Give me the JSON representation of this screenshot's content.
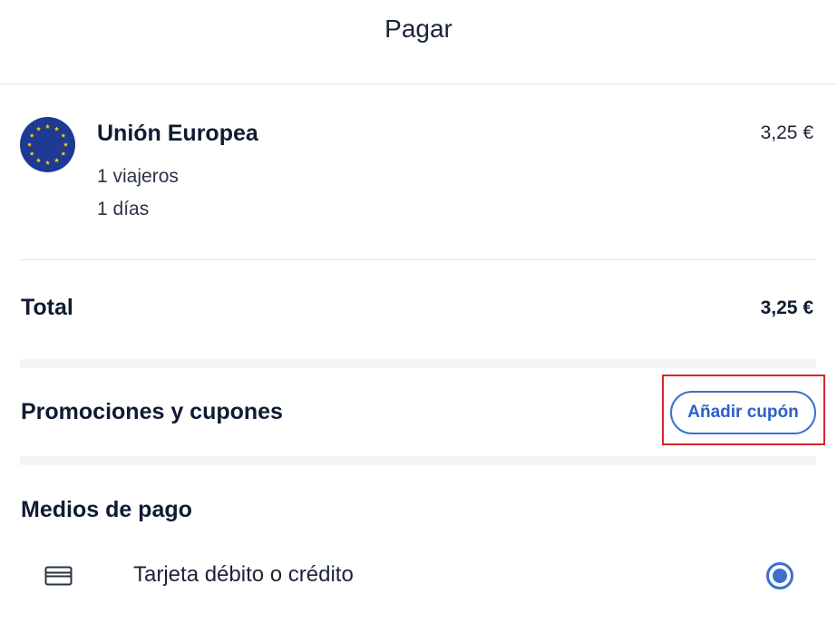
{
  "header": {
    "title": "Pagar"
  },
  "plan": {
    "flag_icon": "eu-flag-icon",
    "name": "Unión Europea",
    "price": "3,25 €",
    "travelers": "1 viajeros",
    "days": "1 días"
  },
  "total": {
    "label": "Total",
    "value": "3,25 €"
  },
  "promotions": {
    "label": "Promociones y cupones",
    "add_coupon_label": "Añadir cupón"
  },
  "payment": {
    "title": "Medios de pago",
    "methods": [
      {
        "icon": "credit-card-icon",
        "label": "Tarjeta débito o crédito",
        "selected": true
      }
    ]
  },
  "colors": {
    "accent": "#3c6fd1",
    "text_primary": "#0f1b33",
    "eu_blue": "#1f3a93",
    "eu_gold": "#f5d300",
    "highlight": "#d9242b",
    "divider": "#dfe2e6"
  }
}
